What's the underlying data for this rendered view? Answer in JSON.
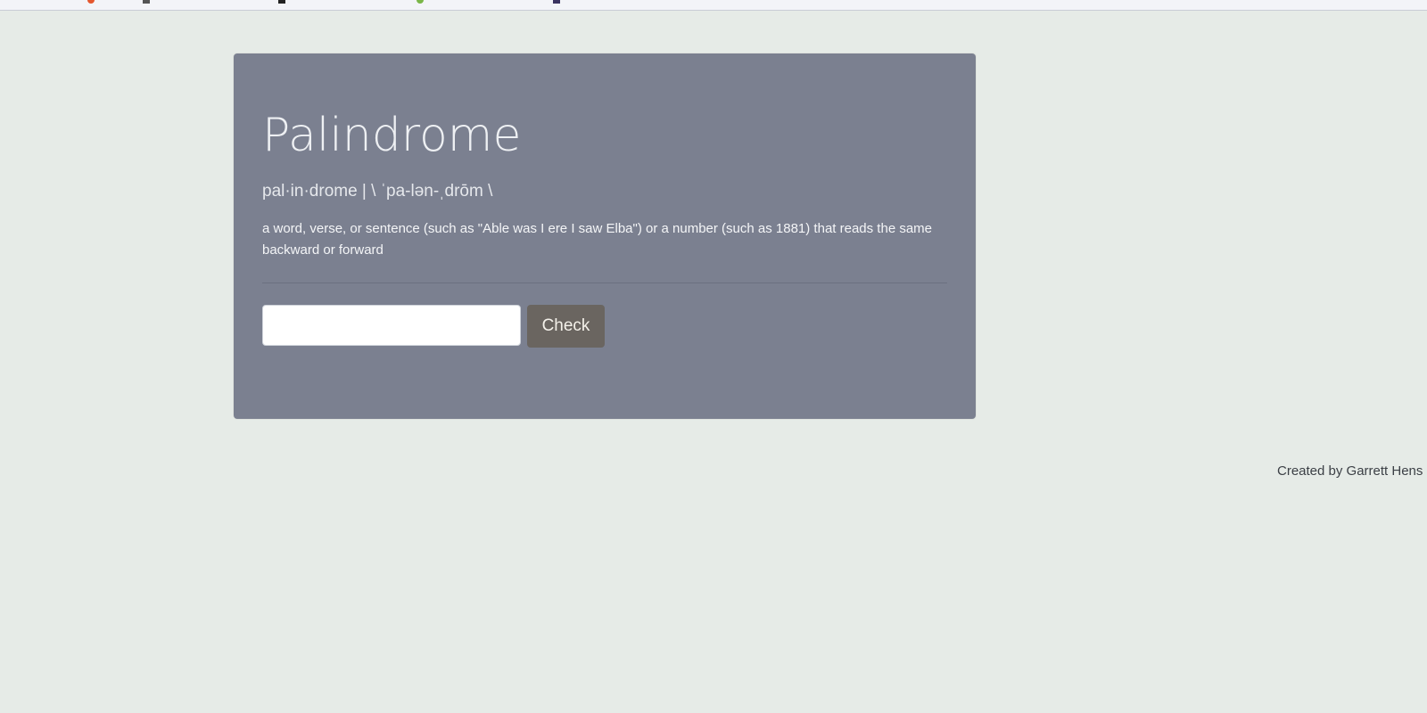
{
  "header": {
    "title": "Palindrome",
    "pronunciation": "pal·in·drome | \\ ˈpa-lən-ˌdrōm \\",
    "definition": "a word, verse, or sentence (such as \"Able was I ere I saw Elba\") or a number (such as 1881) that reads the same backward or forward"
  },
  "form": {
    "input_value": "",
    "input_placeholder": "",
    "check_label": "Check"
  },
  "footer": {
    "credit": "Created by Garrett Hens"
  },
  "colors": {
    "background": "#e6ebe7",
    "card": "#7b8090",
    "button": "#6a6560"
  }
}
